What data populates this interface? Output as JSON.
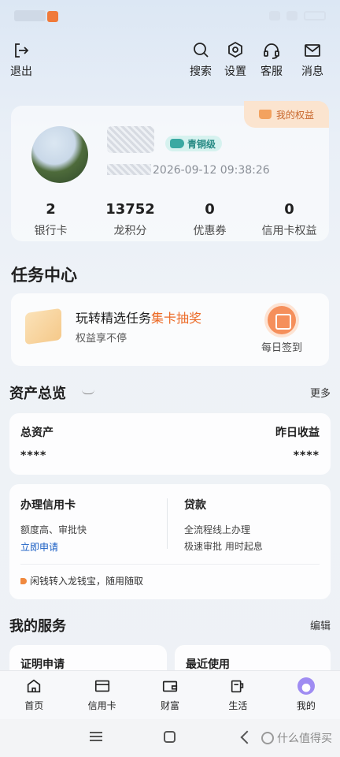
{
  "topbar": {
    "exit_label": "退出",
    "search_label": "搜索",
    "settings_label": "设置",
    "service_label": "客服",
    "message_label": "消息"
  },
  "profile": {
    "rights_label": "我的权益",
    "level": "青铜级",
    "login_time": "2026-09-12 09:38:26",
    "stats": [
      {
        "value": "2",
        "label": "银行卡"
      },
      {
        "value": "13752",
        "label": "龙积分"
      },
      {
        "value": "0",
        "label": "优惠券"
      },
      {
        "value": "0",
        "label": "信用卡权益"
      }
    ]
  },
  "task_center": {
    "title": "任务中心",
    "main_text": "玩转精选任务",
    "highlight_text": "集卡抽奖",
    "sub_text": "权益享不停",
    "signin_label": "每日签到"
  },
  "assets": {
    "title": "资产总览",
    "more_label": "更多",
    "total_label": "总资产",
    "total_value": "****",
    "yesterday_label": "昨日收益",
    "yesterday_value": "****"
  },
  "credit_loan": {
    "credit_title": "办理信用卡",
    "credit_desc": "额度高、审批快",
    "credit_link": "立即申请",
    "loan_title": "贷款",
    "loan_desc1": "全流程线上办理",
    "loan_desc2": "极速审批 用时起息",
    "tip": "闲钱转入龙钱宝，随用随取"
  },
  "services": {
    "title": "我的服务",
    "edit_label": "编辑",
    "left_card": "证明申请",
    "right_card": "最近使用"
  },
  "tabbar": {
    "tabs": [
      {
        "label": "首页"
      },
      {
        "label": "信用卡"
      },
      {
        "label": "财富"
      },
      {
        "label": "生活"
      },
      {
        "label": "我的"
      }
    ]
  },
  "watermark": "什么值得买",
  "colors": {
    "accent_orange": "#ec6a26",
    "link_blue": "#1b5fc4",
    "level_teal": "#268a84"
  }
}
